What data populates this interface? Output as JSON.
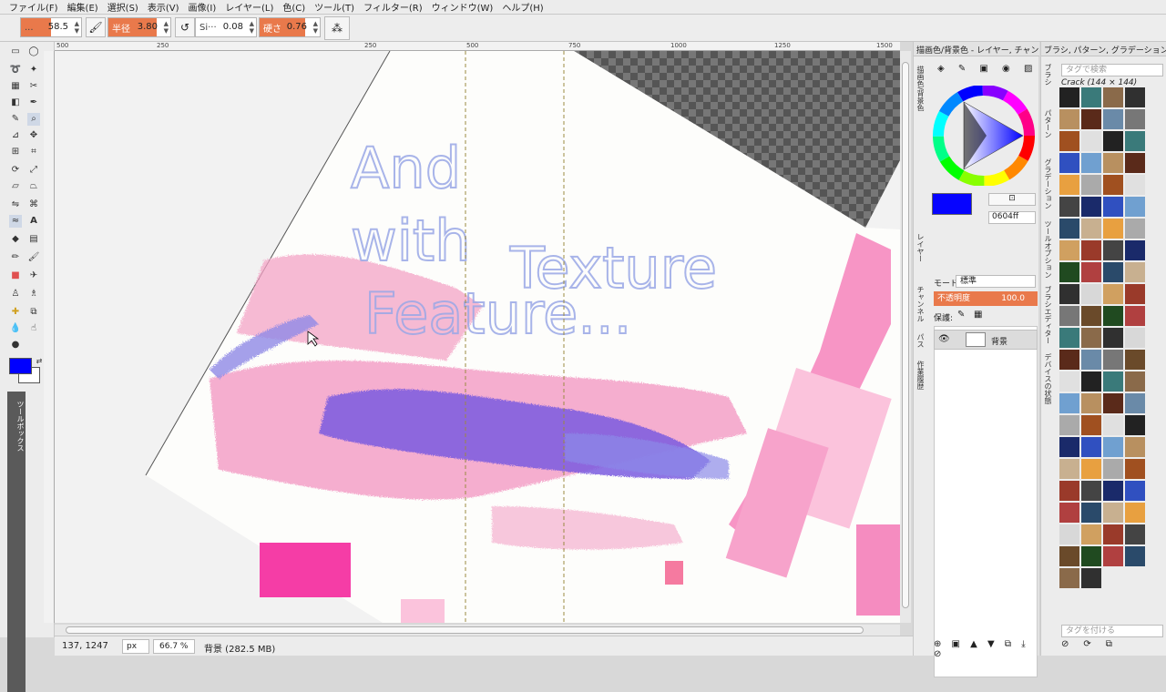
{
  "menu": [
    "ファイル(F)",
    "編集(E)",
    "選択(S)",
    "表示(V)",
    "画像(I)",
    "レイヤー(L)",
    "色(C)",
    "ツール(T)",
    "フィルター(R)",
    "ウィンドウ(W)",
    "ヘルプ(H)"
  ],
  "options": {
    "opacity_label": "...",
    "opacity_value": "58.5",
    "radius_label": "半径",
    "radius_value": "3.80",
    "spacing_label": "Si···",
    "spacing_value": "0.08",
    "hardness_label": "硬さ",
    "hardness_value": "0.76"
  },
  "toolbox": {
    "tab_label": "ツールボックス",
    "fg_color": "#0000ff",
    "bg_color": "#ffffff"
  },
  "ruler": [
    "500",
    "250",
    "250",
    "500",
    "750",
    "1000",
    "1250",
    "1500"
  ],
  "canvas": {
    "text": "And with Texture Feature..."
  },
  "status": {
    "coords": "137, 1247",
    "unit": "px",
    "zoom": "66.7 %",
    "info": "背景 (282.5 MB)"
  },
  "dock1": {
    "title": "描画色/背景色 - レイヤー, チャン",
    "side_tab_1": "描画色/背景色",
    "side_tab_2": "レイヤー",
    "side_tab_3": "チャンネル",
    "side_tab_4": "パス",
    "side_tab_5": "作業履歴",
    "hex_value": "0604ff",
    "mode_label": "モード:",
    "mode_value": "標準",
    "opacity_label": "不透明度",
    "opacity_value": "100.0",
    "lock_label": "保護:",
    "layer_name": "背景",
    "fg_color": "#0604ff"
  },
  "dock2": {
    "title": "ブラシ, パターン, グラデーション,",
    "tag_search_placeholder": "タグで検索",
    "brush_name": "Crack (144 × 144)",
    "tag_assign_placeholder": "タグを付ける",
    "side_tab_1": "ブラシ",
    "side_tab_2": "パターン",
    "side_tab_3": "グラデーション",
    "side_tab_4": "ツールオプション",
    "side_tab_5": "ブラシエディター",
    "side_tab_6": "デバイスの状態"
  }
}
